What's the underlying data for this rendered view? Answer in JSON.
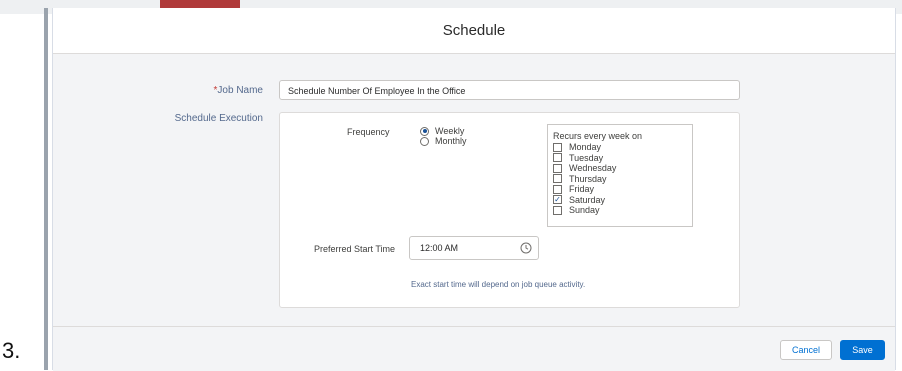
{
  "modal": {
    "title": "Schedule",
    "job_name": {
      "required_marker": "*",
      "label": "Job Name",
      "value": "Schedule Number Of Employee In the Office"
    },
    "schedule_execution": {
      "label": "Schedule Execution",
      "frequency": {
        "label": "Frequency",
        "options": [
          {
            "label": "Weekly",
            "checked": true
          },
          {
            "label": "Monthly",
            "checked": false
          }
        ]
      },
      "recurs": {
        "title": "Recurs every week on",
        "days": [
          {
            "label": "Monday",
            "checked": false
          },
          {
            "label": "Tuesday",
            "checked": false
          },
          {
            "label": "Wednesday",
            "checked": false
          },
          {
            "label": "Thursday",
            "checked": false
          },
          {
            "label": "Friday",
            "checked": false
          },
          {
            "label": "Saturday",
            "checked": true
          },
          {
            "label": "Sunday",
            "checked": false
          }
        ]
      },
      "preferred_start_time": {
        "label": "Preferred Start Time",
        "value": "12:00 AM",
        "icon": "clock-icon"
      },
      "note": "Exact start time will depend on job queue activity."
    },
    "footer": {
      "cancel_label": "Cancel",
      "save_label": "Save"
    }
  },
  "step_number": "3.",
  "colors": {
    "primary": "#0070d2",
    "body_bg": "#f3f4f6",
    "required": "#c23934"
  }
}
